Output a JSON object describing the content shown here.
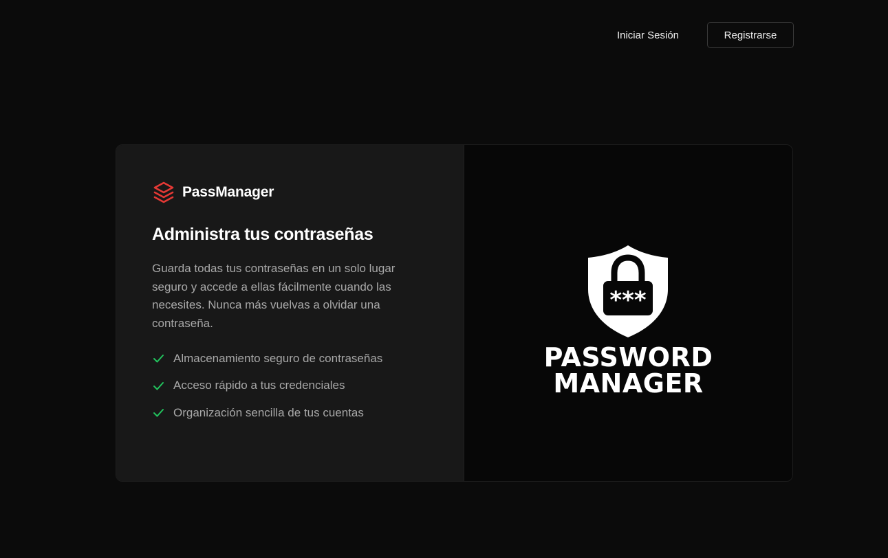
{
  "nav": {
    "login_label": "Iniciar Sesión",
    "register_label": "Registrarse"
  },
  "brand": {
    "name": "PassManager",
    "icon": "stacked-layers-icon",
    "accent": "#e53935"
  },
  "hero": {
    "title": "Administra tus contraseñas",
    "description": "Guarda todas tus contraseñas en un solo lugar seguro y accede a ellas fácilmente cuando las necesites. Nunca más vuelvas a olvidar una contraseña.",
    "features": [
      "Almacenamiento seguro de contraseñas",
      "Acceso rápido a tus credenciales",
      "Organización sencilla de tus cuentas"
    ],
    "check_color": "#22c55e"
  },
  "illustration": {
    "icon": "shield-lock-icon",
    "line1": "PASSWORD",
    "line2": "MANAGER",
    "lock_text": "***"
  }
}
